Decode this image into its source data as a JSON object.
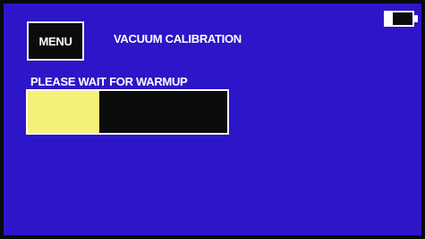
{
  "header": {
    "menu_label": "MENU",
    "title": "VACUUM CALIBRATION"
  },
  "battery": {
    "icon": "battery-icon",
    "level": 0.25
  },
  "warmup": {
    "status_text": "PLEASE WAIT FOR WARMUP",
    "progress": 0.36
  },
  "colors": {
    "background": "#2d16c8",
    "progress_fill": "#f4f07a",
    "progress_track": "#0c0c0c",
    "text": "#ffffff"
  }
}
